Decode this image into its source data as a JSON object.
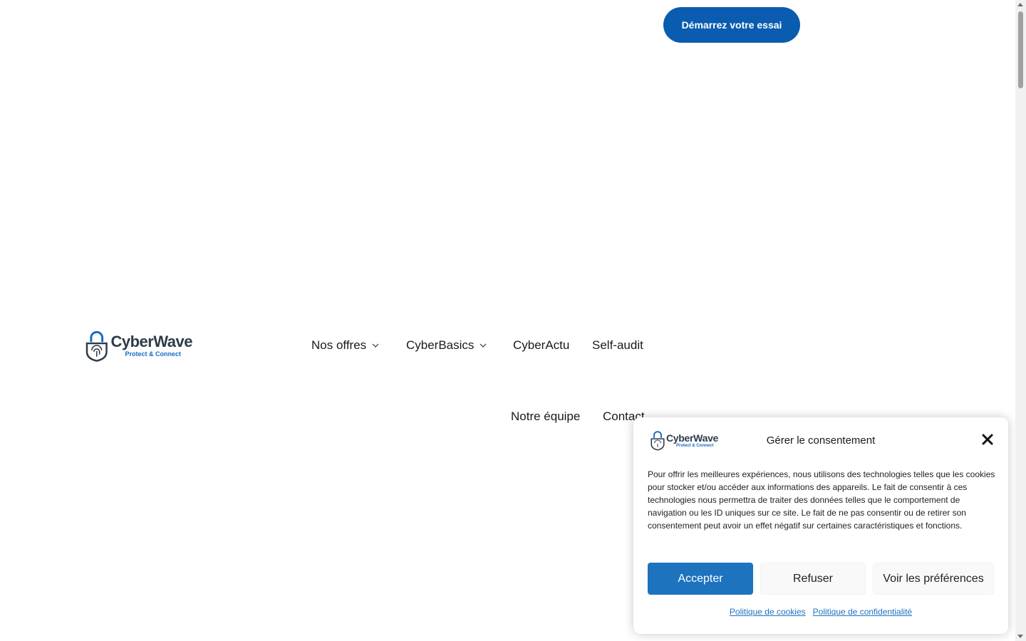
{
  "header": {
    "cta_label": "Démarrez votre essai"
  },
  "logo": {
    "name": "CyberWave",
    "tagline": "Protect & Connect"
  },
  "nav": {
    "items": [
      {
        "label": "Nos offres",
        "has_dropdown": true
      },
      {
        "label": "CyberBasics",
        "has_dropdown": true
      },
      {
        "label": "CyberActu",
        "has_dropdown": false
      },
      {
        "label": "Self-audit",
        "has_dropdown": false
      },
      {
        "label": "Notre équipe",
        "has_dropdown": false
      },
      {
        "label": "Contact",
        "has_dropdown": false
      }
    ]
  },
  "consent": {
    "title": "Gérer le consentement",
    "body": "Pour offrir les meilleures expériences, nous utilisons des technologies telles que les cookies pour stocker et/ou accéder aux informations des appareils. Le fait de consentir à ces technologies nous permettra de traiter des données telles que le comportement de navigation ou les ID uniques sur ce site. Le fait de ne pas consentir ou de retirer son consentement peut avoir un effet négatif sur certaines caractéristiques et fonctions.",
    "accept_label": "Accepter",
    "refuse_label": "Refuser",
    "preferences_label": "Voir les préférences",
    "cookie_policy_label": "Politique de cookies",
    "privacy_policy_label": "Politique de confidentialité"
  },
  "colors": {
    "brand_blue": "#0a5cb0",
    "accept_blue": "#1e73be",
    "logo_dark": "#2f3a4a"
  },
  "icons": {
    "logo": "padlock-fingerprint-icon",
    "dropdown": "chevron-down-icon",
    "close": "close-icon"
  }
}
